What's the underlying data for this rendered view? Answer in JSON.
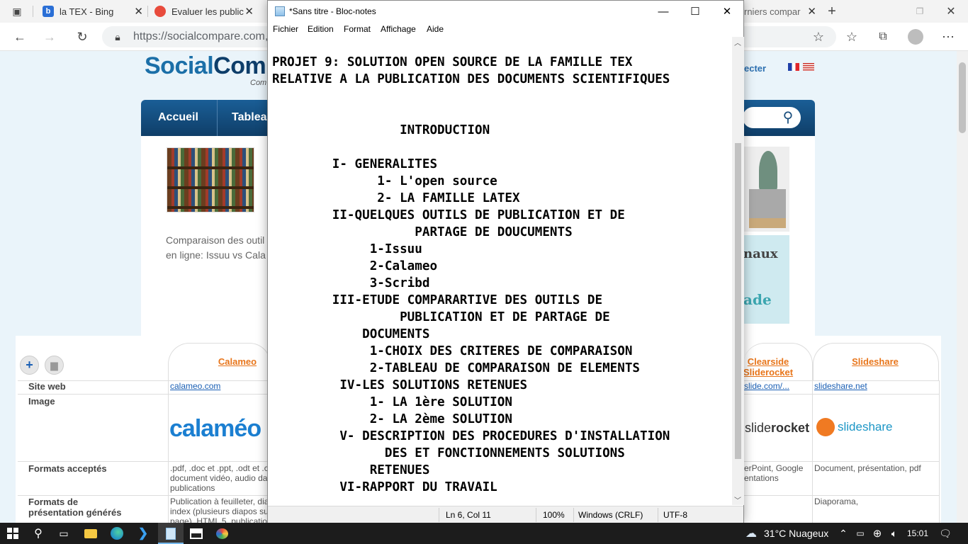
{
  "browser": {
    "tabs": [
      {
        "title": "la TEX - Bing",
        "favicon_color": "#2a6fd6"
      },
      {
        "title": "Evaluer les public",
        "favicon_color": "#e84b3c"
      },
      {
        "title": "rniers compar",
        "favicon_color": "#e6a400"
      }
    ],
    "url": "https://socialcompare.com,"
  },
  "site": {
    "logo_part1": "Social",
    "logo_part2": "Com",
    "logo_sub": "Com",
    "connect_label": "ecter",
    "nav": [
      "Accueil",
      "Tablea"
    ],
    "intro_lines": [
      "Comparaison des outil",
      "en ligne: Issuu vs Cala"
    ],
    "promo_line1": "naux",
    "promo_line2": "ade",
    "columns": [
      {
        "name": "Calameo"
      },
      {
        "name_line1": "Clearside",
        "name_line2": "Sliderocket"
      },
      {
        "name": "Slideshare"
      }
    ],
    "rows": {
      "site_web": "Site web",
      "image": "Image",
      "formats_acceptes": "Formats acceptés",
      "formats_pres_line1": "Formats de",
      "formats_pres_line2": "présentation générés"
    },
    "cells": {
      "calameo_site": "calameo.com",
      "clearside_site": "slide.com/...",
      "slideshare_site": "slideshare.net",
      "calameo_logo": "calaméo",
      "sliderocket_logo_a": "slide",
      "sliderocket_logo_b": "rocket",
      "slideshare_logo": "slideshare",
      "calameo_formats_l1": ".pdf, .doc et .ppt, .odt et .c",
      "calameo_formats_l2": "document vidéo, audio da",
      "calameo_formats_l3": "publications",
      "clearside_formats_l1": "erPoint, Google",
      "clearside_formats_l2": "entations",
      "slideshare_formats": "Document, présentation, pdf",
      "calameo_pres_l1": "Publication à feuilleter, dia",
      "calameo_pres_l2": "index (plusieurs diapos su",
      "calameo_pres_l3": "page), HTML 5, publication",
      "slideshare_pres": "Diaporama,"
    }
  },
  "notepad": {
    "title": "*Sans titre - Bloc-notes",
    "menu": [
      "Fichier",
      "Edition",
      "Format",
      "Affichage",
      "Aide"
    ],
    "text": "PROJET 9: SOLUTION OPEN SOURCE DE LA FAMILLE TEX\nRELATIVE A LA PUBLICATION DES DOCUMENTS SCIENTIFIQUES\n\n\n                 INTRODUCTION\n\n        I- GENERALITES\n              1- L'open source\n              2- LA FAMILLE LATEX\n        II-QUELQUES OUTILS DE PUBLICATION ET DE\n                   PARTAGE DE DOUCUMENTS\n             1-Issuu\n             2-Calameo\n             3-Scribd\n        III-ETUDE COMPARARTIVE DES OUTILS DE\n                 PUBLICATION ET DE PARTAGE DE\n            DOCUMENTS\n             1-CHOIX DES CRITERES DE COMPARAISON\n             2-TABLEAU DE COMPARAISON DE ELEMENTS\n         IV-LES SOLUTIONS RETENUES\n             1- LA 1ère SOLUTION\n             2- LA 2ème SOLUTION\n         V- DESCRIPTION DES PROCEDURES D'INSTALLATION\n               DES ET FONCTIONNEMENTS SOLUTIONS\n             RETENUES\n         VI-RAPPORT DU TRAVAIL",
    "status": {
      "position": "Ln 6, Col 11",
      "zoom": "100%",
      "line_endings": "Windows (CRLF)",
      "encoding": "UTF-8"
    }
  },
  "taskbar": {
    "weather": "31°C  Nuageux",
    "time": "15:01"
  }
}
